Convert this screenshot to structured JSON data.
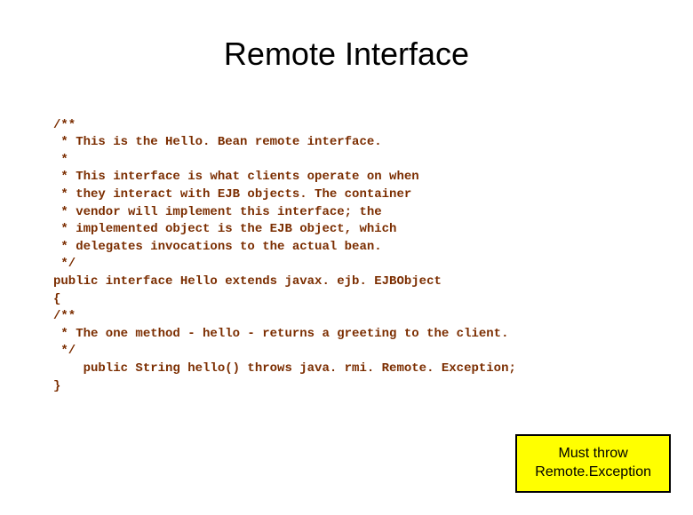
{
  "title": "Remote Interface",
  "code": {
    "lines": [
      "/**",
      " * This is the Hello. Bean remote interface.",
      " *",
      " * This interface is what clients operate on when",
      " * they interact with EJB objects. The container",
      " * vendor will implement this interface; the",
      " * implemented object is the EJB object, which",
      " * delegates invocations to the actual bean.",
      " */",
      "public interface Hello extends javax. ejb. EJBObject",
      "{",
      "/**",
      " * The one method - hello - returns a greeting to the client.",
      " */",
      "    public String hello() throws java. rmi. Remote. Exception;",
      "}"
    ]
  },
  "callout": {
    "line1": "Must throw",
    "line2": "Remote.Exception"
  }
}
